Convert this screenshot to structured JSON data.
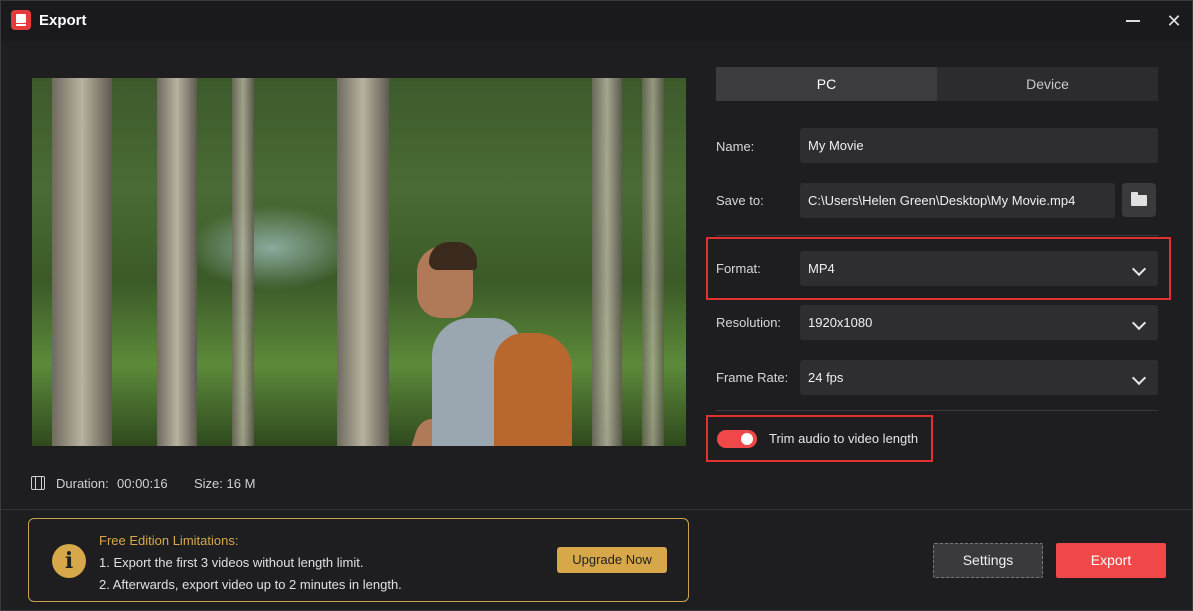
{
  "window": {
    "title": "Export",
    "minimize_icon": "minimize-icon",
    "close_icon": "close-icon",
    "close_glyph": "✕"
  },
  "preview": {
    "duration_label": "Duration:",
    "duration_value": "00:00:16",
    "size_label": "Size: 16 M"
  },
  "tabs": [
    {
      "label": "PC",
      "active": true
    },
    {
      "label": "Device",
      "active": false
    }
  ],
  "form": {
    "name_label": "Name:",
    "name_value": "My Movie",
    "save_label": "Save to:",
    "save_value": "C:\\Users\\Helen Green\\Desktop\\My Movie.mp4",
    "format_label": "Format:",
    "format_value": "MP4",
    "resolution_label": "Resolution:",
    "resolution_value": "1920x1080",
    "framerate_label": "Frame Rate:",
    "framerate_value": "24 fps",
    "trim_label": "Trim audio to video length",
    "trim_enabled": true
  },
  "notice": {
    "title": "Free Edition Limitations:",
    "line1": "1. Export the first 3 videos without length limit.",
    "line2": "2. Afterwards, export video up to 2 minutes in length.",
    "icon_glyph": "i",
    "upgrade_label": "Upgrade Now"
  },
  "actions": {
    "settings_label": "Settings",
    "export_label": "Export"
  },
  "colors": {
    "accent": "#f04848",
    "notice": "#d7a84a",
    "highlight": "#e03030"
  }
}
